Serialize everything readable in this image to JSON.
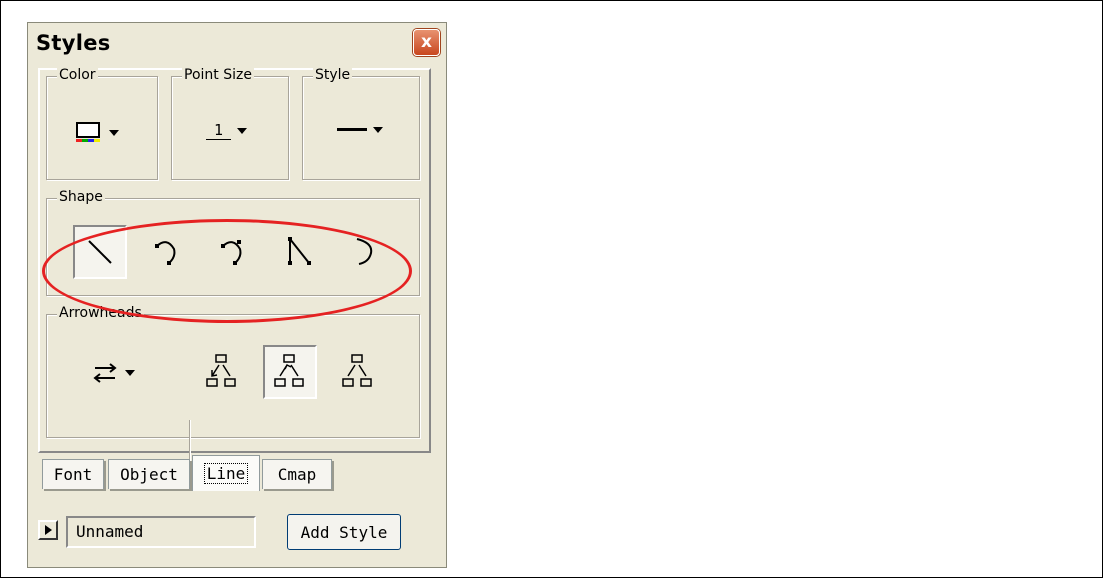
{
  "window": {
    "title": "Styles",
    "close_glyph": "x"
  },
  "groups": {
    "color": {
      "label": "Color",
      "icon": "color-picker-icon",
      "swatch_colors": [
        "#e22",
        "#0a0",
        "#22e",
        "#ee0"
      ]
    },
    "point_size": {
      "label": "Point Size",
      "value": "1"
    },
    "style": {
      "label": "Style",
      "icon": "solid-line-icon"
    },
    "shape": {
      "label": "Shape",
      "options": [
        "straight-line-icon",
        "curved-line-icon",
        "curved-line-with-points-icon",
        "segmented-line-icon",
        "arc-icon"
      ],
      "selected_index": 0
    },
    "arrowheads": {
      "label": "Arrowheads",
      "options": [
        "arrow-direction-icon",
        "arrow-to-left-child-icon",
        "arrow-to-all-children-icon",
        "no-arrows-icon"
      ],
      "selected_index": 2
    }
  },
  "tabs": [
    "Font",
    "Object",
    "Line",
    "Cmap"
  ],
  "active_tab": "Line",
  "style_name": {
    "value": "Unnamed"
  },
  "add_style_label": "Add Style",
  "highlight_color": "#e52222"
}
